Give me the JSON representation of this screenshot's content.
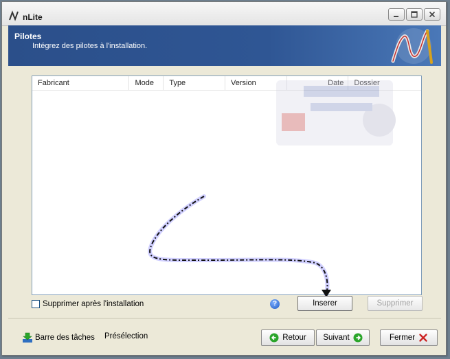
{
  "window": {
    "title": "nLite",
    "controls": [
      "minimize-icon",
      "maximize-icon",
      "close-icon"
    ]
  },
  "header": {
    "title": "Pilotes",
    "subtitle": "Intégrez des pilotes à l'installation."
  },
  "drivers_list": {
    "columns": [
      "Fabricant",
      "Mode",
      "Type",
      "Version",
      "Date",
      "Dossier"
    ],
    "rows": []
  },
  "options": {
    "delete_after_install_label": "Supprimer après l'installation",
    "delete_after_install_checked": false
  },
  "actions": {
    "insert_label": "Inserer",
    "delete_label": "Supprimer",
    "delete_enabled": false
  },
  "footer": {
    "taskbar_label": "Barre des tâches",
    "preset_label": "Présélection",
    "back_label": "Retour",
    "next_label": "Suivant",
    "close_label": "Fermer"
  },
  "colors": {
    "header_bg": "#2f5694",
    "accent_green": "#2aa52a",
    "close_red": "#cc2222"
  }
}
